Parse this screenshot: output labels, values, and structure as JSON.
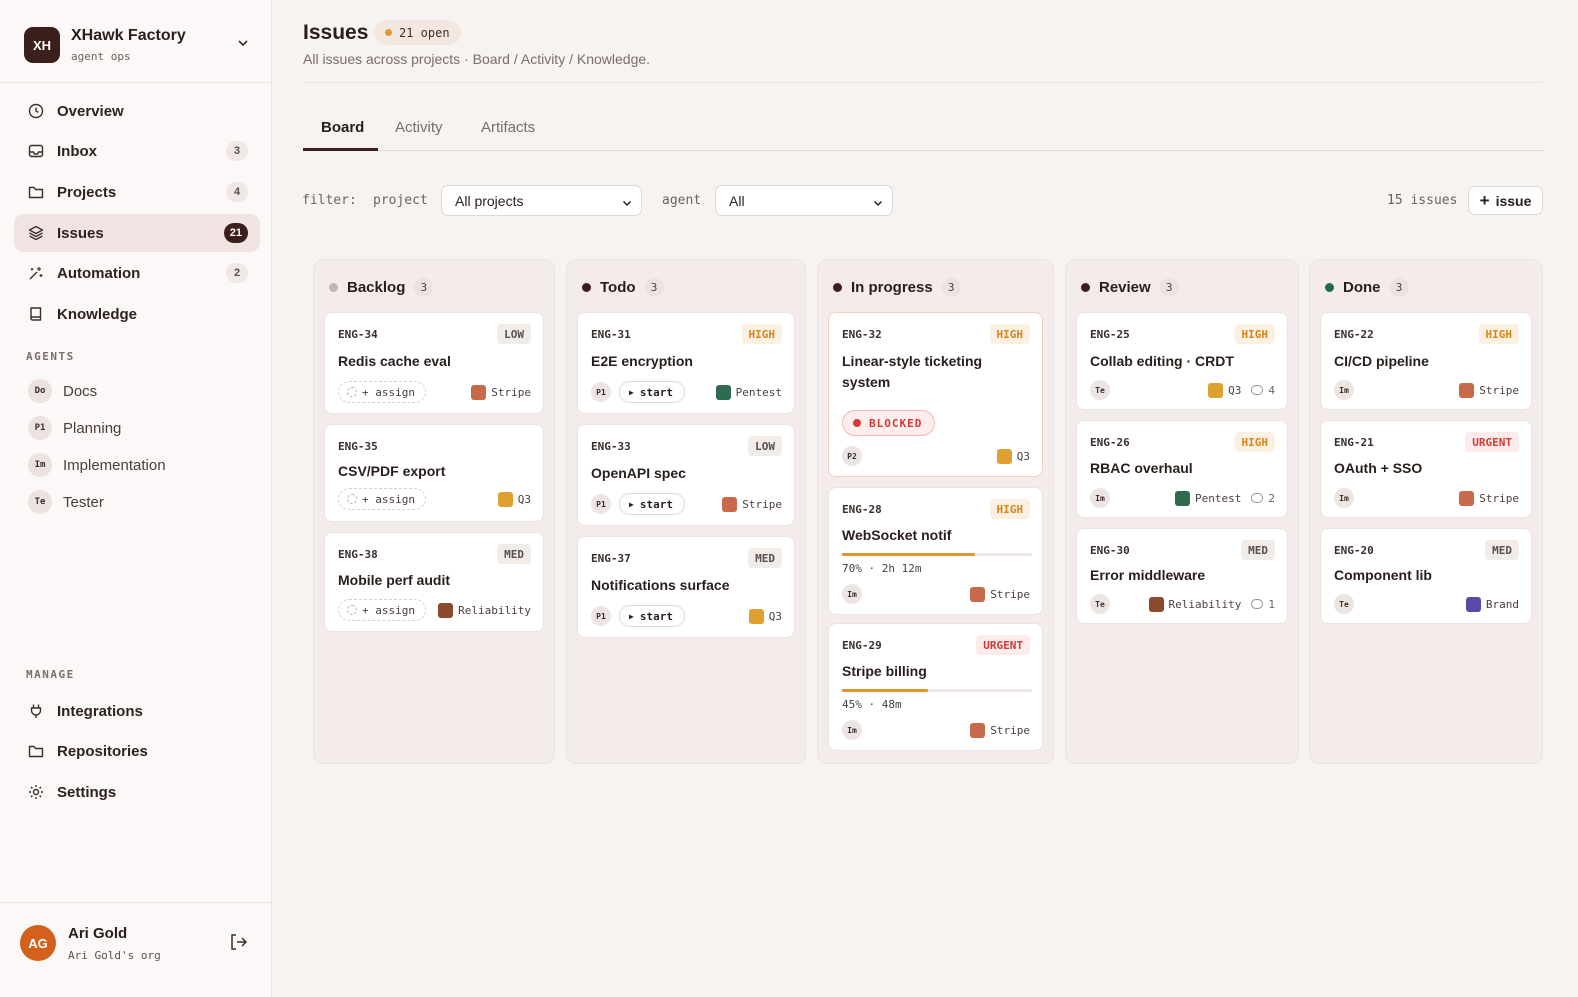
{
  "workspace": {
    "initials": "XH",
    "name": "XHawk Factory",
    "subtitle": "agent ops"
  },
  "nav": [
    {
      "label": "Overview",
      "icon": "clock-icon",
      "count": ""
    },
    {
      "label": "Inbox",
      "icon": "inbox-icon",
      "count": "3"
    },
    {
      "label": "Projects",
      "icon": "folder-icon",
      "count": "4"
    },
    {
      "label": "Issues",
      "icon": "layers-icon",
      "count": "21",
      "active": true
    },
    {
      "label": "Automation",
      "icon": "sparkle-icon",
      "count": "2"
    },
    {
      "label": "Knowledge",
      "icon": "book-icon",
      "count": ""
    }
  ],
  "agents_label": "AGENTS",
  "agents": [
    {
      "initials": "Do",
      "label": "Docs"
    },
    {
      "initials": "P1",
      "label": "Planning"
    },
    {
      "initials": "Im",
      "label": "Implementation"
    },
    {
      "initials": "Te",
      "label": "Tester"
    }
  ],
  "manage_label": "MANAGE",
  "manage": [
    {
      "label": "Integrations",
      "icon": "plug-icon"
    },
    {
      "label": "Repositories",
      "icon": "folder-icon"
    },
    {
      "label": "Settings",
      "icon": "gear-icon"
    }
  ],
  "user": {
    "initials": "AG",
    "name": "Ari Gold",
    "org": "Ari Gold's org"
  },
  "header": {
    "title": "Issues",
    "open_badge": "21 open",
    "subtitle": "All issues across projects · Board / Activity / Knowledge."
  },
  "tabs": [
    "Board",
    "Activity",
    "Artifacts"
  ],
  "filters": {
    "filter_label": "filter:",
    "project_label": "project",
    "project_value": "All projects",
    "agent_label": "agent",
    "agent_value": "All",
    "issue_count": "15 issues",
    "add_label": "issue"
  },
  "colors": {
    "accent": "#3b1f1c",
    "high": "#d68519",
    "urgent": "#d23a36",
    "backlog": "#c2b5b2",
    "todo": "#3b1f1c",
    "in_progress": "#3b1f1c",
    "review": "#3b1f1c",
    "done": "#1f6b4c"
  },
  "columns": [
    {
      "name": "Backlog",
      "count": "3",
      "dot": "#c2b5b2",
      "cards": [
        {
          "id": "ENG-34",
          "prio": "LOW",
          "title": "Redis cache eval",
          "assign": "+ assign",
          "project": "Stripe"
        },
        {
          "id": "ENG-35",
          "prio": "",
          "title": "CSV/PDF export",
          "assign": "+ assign",
          "project": "Q3"
        },
        {
          "id": "ENG-38",
          "prio": "MED",
          "title": "Mobile perf audit",
          "assign": "+ assign",
          "project": "Reliability"
        }
      ]
    },
    {
      "name": "Todo",
      "count": "3",
      "dot": "#3b1f1c",
      "cards": [
        {
          "id": "ENG-31",
          "prio": "HIGH",
          "title": "E2E encryption",
          "agent": "P1",
          "action": "start",
          "project": "Pentest"
        },
        {
          "id": "ENG-33",
          "prio": "LOW",
          "title": "OpenAPI spec",
          "agent": "P1",
          "action": "start",
          "project": "Stripe"
        },
        {
          "id": "ENG-37",
          "prio": "MED",
          "title": "Notifications surface",
          "agent": "P1",
          "action": "start",
          "project": "Q3"
        }
      ]
    },
    {
      "name": "In progress",
      "count": "3",
      "dot": "#3b1f1c",
      "cards": [
        {
          "id": "ENG-32",
          "prio": "HIGH",
          "title_l1": "Linear-style ticketing",
          "title_l2": "system",
          "status": "BLOCKED",
          "agent": "P2",
          "project": "Q3"
        },
        {
          "id": "ENG-28",
          "prio": "HIGH",
          "title": "WebSocket notif",
          "progress": 0.7,
          "progress_text": "70% · 2h 12m",
          "agent": "Im",
          "project": "Stripe"
        },
        {
          "id": "ENG-29",
          "prio": "URGENT",
          "title": "Stripe billing",
          "progress": 0.45,
          "progress_text": "45% · 48m",
          "agent": "Im",
          "project": "Stripe"
        }
      ]
    },
    {
      "name": "Review",
      "count": "3",
      "dot": "#3b1f1c",
      "cards": [
        {
          "id": "ENG-25",
          "prio": "HIGH",
          "title": "Collab editing · CRDT",
          "agent": "Te",
          "project": "Q3",
          "comments": "4"
        },
        {
          "id": "ENG-26",
          "prio": "HIGH",
          "title": "RBAC overhaul",
          "agent": "Im",
          "project": "Pentest",
          "comments": "2"
        },
        {
          "id": "ENG-30",
          "prio": "MED",
          "title": "Error middleware",
          "agent": "Te",
          "project": "Reliability",
          "comments": "1"
        }
      ]
    },
    {
      "name": "Done",
      "count": "3",
      "dot": "#1f6b4c",
      "cards": [
        {
          "id": "ENG-22",
          "prio": "HIGH",
          "title": "CI/CD pipeline",
          "agent": "Im",
          "project": "Stripe"
        },
        {
          "id": "ENG-21",
          "prio": "URGENT",
          "title": "OAuth + SSO",
          "agent": "Im",
          "project": "Stripe"
        },
        {
          "id": "ENG-20",
          "prio": "MED",
          "title": "Component lib",
          "agent": "Te",
          "project": "Brand"
        }
      ]
    }
  ]
}
